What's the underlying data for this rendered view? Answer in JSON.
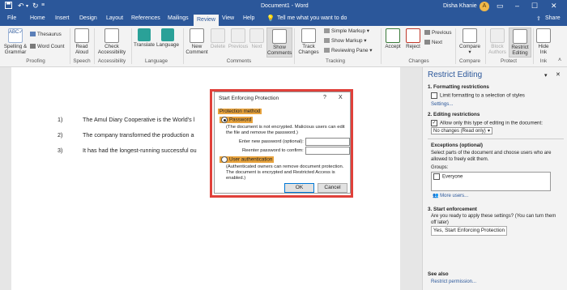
{
  "titlebar": {
    "title": "Document1 - Word",
    "user_name": "Disha Khanie",
    "avatar_letter": "A"
  },
  "tabs": {
    "items": [
      "File",
      "Home",
      "Insert",
      "Design",
      "Layout",
      "References",
      "Mailings",
      "Review",
      "View",
      "Help"
    ],
    "active": "Review",
    "tell_me": "Tell me what you want to do",
    "share": "Share"
  },
  "ribbon": {
    "spelling": "Spelling &",
    "grammar": "Grammar",
    "thesaurus": "Thesaurus",
    "word_count": "Word Count",
    "read_aloud": "Read",
    "read_aloud2": "Aloud",
    "check_acc": "Check",
    "check_acc2": "Accessibility",
    "translate": "Translate",
    "language": "Language",
    "new_comment": "New",
    "new_comment2": "Comment",
    "delete": "Delete",
    "previous": "Previous",
    "next": "Next",
    "show_comments": "Show",
    "show_comments2": "Comments",
    "simple_markup": "Simple Markup",
    "show_markup": "Show Markup",
    "reviewing_pane": "Reviewing Pane",
    "track": "Track",
    "track2": "Changes",
    "accept": "Accept",
    "reject": "Reject",
    "prev_change": "Previous",
    "next_change": "Next",
    "compare": "Compare",
    "block": "Block",
    "block2": "Authors",
    "restrict": "Restrict",
    "restrict2": "Editing",
    "hide_ink": "Hide",
    "hide_ink2": "Ink",
    "groups": {
      "proofing": "Proofing",
      "speech": "Speech",
      "accessibility": "Accessibility",
      "language": "Language",
      "comments": "Comments",
      "tracking": "Tracking",
      "changes": "Changes",
      "compare": "Compare",
      "protect": "Protect",
      "ink": "Ink"
    }
  },
  "document": {
    "lines": [
      {
        "num": "1)",
        "text": "The Amul Diary Cooperative is the World’s l"
      },
      {
        "num": "2)",
        "text": "The company transformed the production a"
      },
      {
        "num": "3)",
        "text": "It has had the longest-running successful ou"
      }
    ]
  },
  "dialog": {
    "title": "Start Enforcing Protection",
    "help": "?",
    "close": "X",
    "section": "Protection method",
    "password_label": "Password",
    "password_desc": "(The document is not encrypted. Malicious users can edit the file and remove the password.)",
    "enter_label": "Enter new password (optional):",
    "reenter_label": "Reenter password to confirm:",
    "userauth_label": "User authentication",
    "userauth_desc": "(Authenticated owners can remove document protection. The document is encrypted and Restricted Access is enabled.)",
    "ok": "OK",
    "cancel": "Cancel"
  },
  "pane": {
    "title": "Restrict Editing",
    "s1_title": "1. Formatting restrictions",
    "s1_check": "Limit formatting to a selection of styles",
    "s1_link": "Settings...",
    "s2_title": "2. Editing restrictions",
    "s2_check": "Allow only this type of editing in the document:",
    "s2_select": "No changes (Read only)",
    "exc_title": "Exceptions (optional)",
    "exc_desc": "Select parts of the document and choose users who are allowed to freely edit them.",
    "groups_label": "Groups:",
    "everyone": "Everyone",
    "more_users": "More users...",
    "s3_title": "3. Start enforcement",
    "s3_desc": "Are you ready to apply these settings? (You can turn them off later)",
    "s3_button": "Yes, Start Enforcing Protection",
    "see_also": "See also",
    "restrict_link": "Restrict permission..."
  },
  "colors": {
    "word_blue": "#2b579a",
    "highlight": "#e8a33d",
    "red_frame": "#e0403a"
  }
}
